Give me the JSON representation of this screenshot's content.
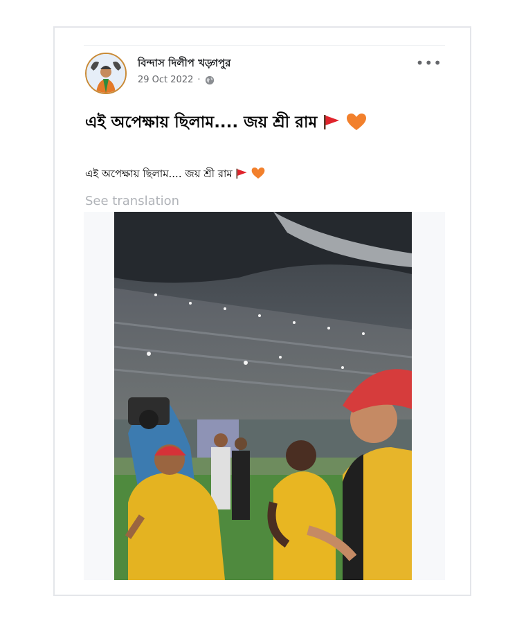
{
  "post": {
    "author": "বিন্দাস দিলীপ খড়্গপুর",
    "date": "29 Oct 2022",
    "separator": "·",
    "title_text": "এই অপেক্ষায় ছিলাম.... জয় শ্রী রাম",
    "body_text": "এই অপেক্ষায় ছিলাম.... জয় শ্রী রাম",
    "see_translation": "See translation",
    "more_label": "•••",
    "icons": {
      "privacy": "globe-icon",
      "more": "more-options-icon",
      "flag": "red-flag-emoji",
      "heart": "orange-heart-emoji"
    }
  },
  "colors": {
    "flag": "#e0242c",
    "heart": "#f2802c",
    "card_border": "#e4e6ea",
    "link_muted": "#b0b3b8"
  }
}
